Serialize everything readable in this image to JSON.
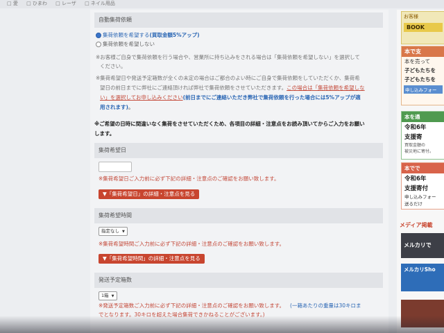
{
  "top_strip": [
    "□ 愛",
    "□ ひまわ",
    "□ レーザ",
    "□ ネイル用品"
  ],
  "section_auto": {
    "heading": "自動集荷依頼",
    "radio_on": "集荷依頼を希望する",
    "radio_on_note": "(買取金額5%アップ)",
    "radio_off": "集荷依頼を希望しない",
    "note1a": "※お客様ご自身で集荷依頼を行う場合や、営業所に持ち込みをされる場合は「集荷依頼を希望しない」を選択して",
    "note1b": "ください。",
    "note2a": "※集荷希望日や発送予定箱数が全くの未定の場合はご都合のよい時にご自身で集荷依頼をしていただくか、集荷希",
    "note2b": "望日の前日までに弊社にご連絡頂ければ弊社で集荷依頼をさせていただきます。",
    "note2b_link": "この場合は「集荷依頼を希望しな",
    "note2c_link": "い」を選択してお申し込みください",
    "note2c_blue": "(前日までにご連絡いただき弊社で集荷依頼を行った場合には5%アップが適",
    "note2d_blue": "用されます)",
    "note2d_end": "。"
  },
  "warning": {
    "line1": "※ご希望の日時に間違いなく集荷をさせていただくため、各項目の詳細・注意点をお読み頂いてからご入力をお願い",
    "line2": "します。"
  },
  "pickup_date": {
    "heading": "集荷希望日",
    "note": "※集荷希望日ご入力前に必ず下記の詳細・注意点のご確認をお願い致します。",
    "button": "▼「集荷希望日」の詳細・注意点を見る"
  },
  "pickup_time": {
    "heading": "集荷希望時間",
    "selected": "指定なし",
    "note": "※集荷希望時間ご入力前に必ず下記の詳細・注意点のご確認をお願い致します。",
    "button": "▼「集荷希望時間」の詳細・注意点を見る"
  },
  "boxes": {
    "heading": "発送予定箱数",
    "selected": "1箱",
    "note1": "※発送予定箱数ご入力前に必ず下記の詳細・注意点のご確認をお願い致します。",
    "note1_tail": "(一箱あたりの重量は30キロま",
    "note2": "でとなります。30キロを超えた場合集荷できかねることがございます。)"
  },
  "right_ads": {
    "ad1": "お客様",
    "ad1b": "BOOK",
    "ad2_title": "本で支",
    "ad2_l1": "本を売って",
    "ad2_l2": "子どもたちを",
    "ad2_l3": "子どもたちを",
    "ad2_l4": "申し込みフォー",
    "ad3_title": "本を通",
    "ad3_l1": "令和6年",
    "ad3_l2": "支援寄",
    "ad3_l3": "買取金額の",
    "ad3_l4": "被災地に寄付。",
    "ad4_title": "本でで",
    "ad4_l1": "令和6年",
    "ad4_l2": "支援寄付",
    "ad4_l3": "申し込みフォー",
    "ad4_l4": "送るだけ",
    "media_heading": "メディア掲載",
    "media1": "メルカリで",
    "media2": "メルカリSho"
  },
  "colors": {
    "accent_red": "#c8452f",
    "link_blue": "#2a66b4",
    "radio_selected": "#3a74c9"
  }
}
